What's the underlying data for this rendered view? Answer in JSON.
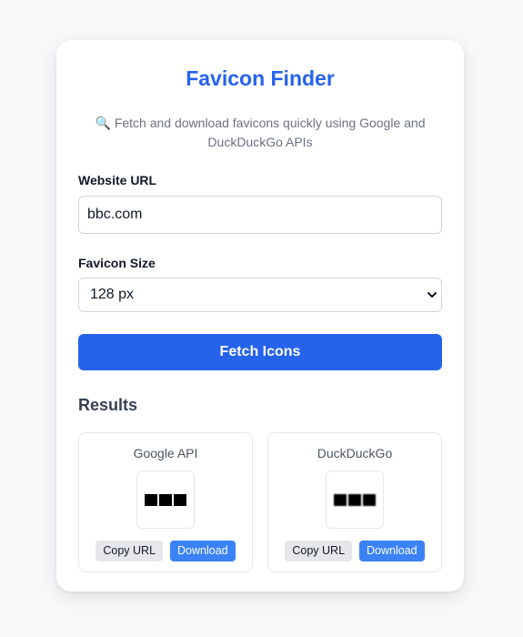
{
  "header": {
    "title": "Favicon Finder",
    "subtitle_icon": "🔍",
    "subtitle": "Fetch and download favicons quickly using Google and DuckDuckGo APIs"
  },
  "form": {
    "url_label": "Website URL",
    "url_value": "bbc.com",
    "size_label": "Favicon Size",
    "size_selected": "128 px",
    "fetch_label": "Fetch Icons"
  },
  "results": {
    "title": "Results",
    "items": [
      {
        "name": "Google API",
        "icon": "bbc-favicon",
        "copy_label": "Copy URL",
        "download_label": "Download"
      },
      {
        "name": "DuckDuckGo",
        "icon": "bbc-favicon",
        "copy_label": "Copy URL",
        "download_label": "Download"
      }
    ]
  },
  "colors": {
    "accent": "#2563eb",
    "download": "#3b82f6",
    "background": "#f7f8fa"
  }
}
